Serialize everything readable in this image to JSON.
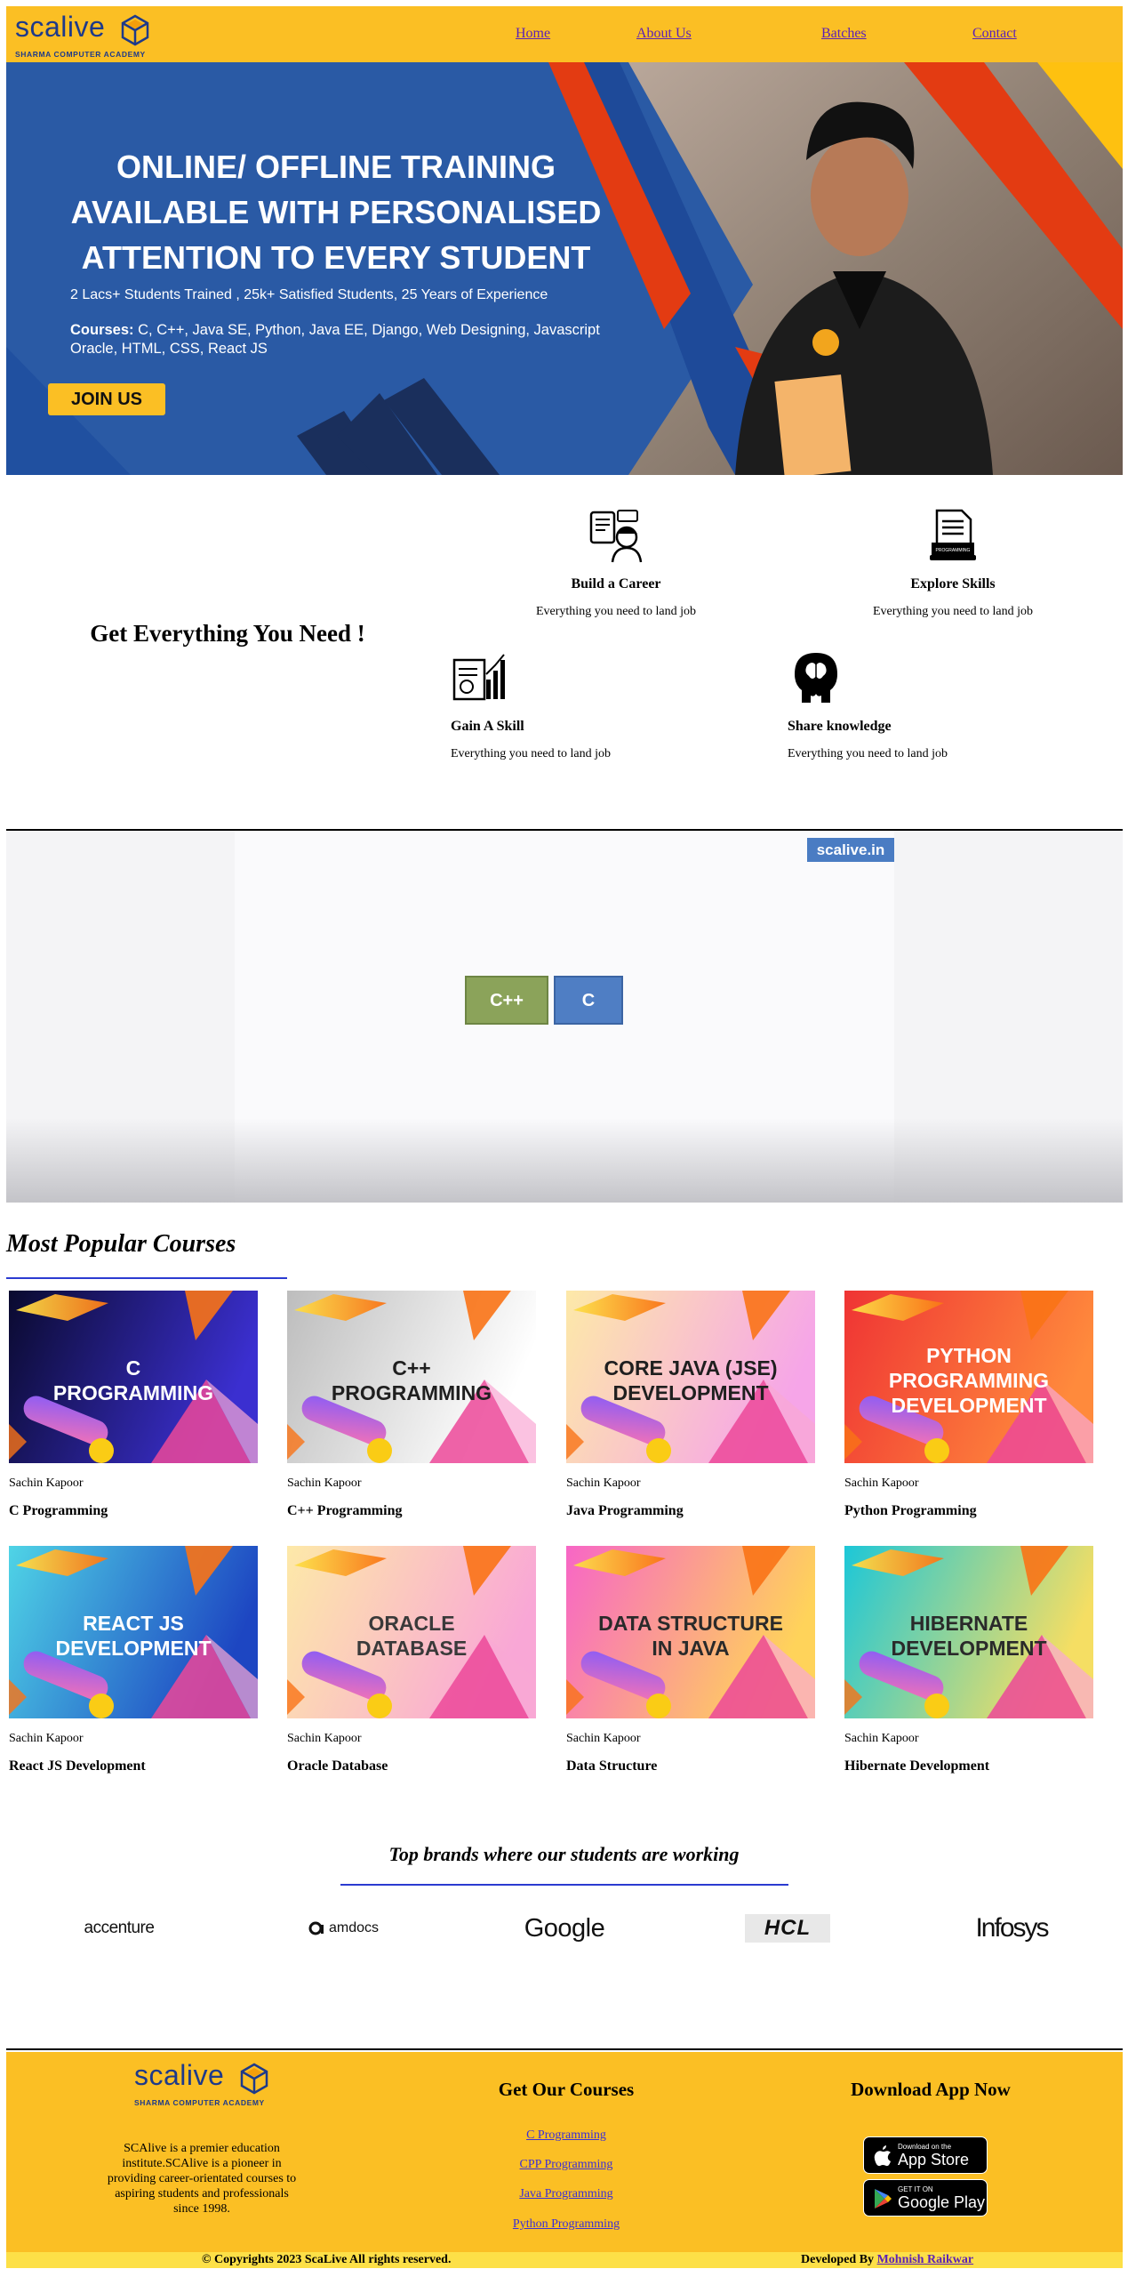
{
  "brand": {
    "name": "scalive",
    "tagline": "SHARMA COMPUTER ACADEMY"
  },
  "nav": {
    "links": [
      "Home",
      "About Us",
      "Batches",
      "Contact"
    ]
  },
  "hero": {
    "title_lines": [
      "ONLINE/ OFFLINE TRAINING",
      "AVAILABLE WITH PERSONALISED",
      "ATTENTION TO EVERY STUDENT"
    ],
    "stats": "2 Lacs+ Students Trained , 25k+ Satisfied Students, 25 Years of Experience",
    "courses_label": "Courses:",
    "courses_line1": " C, C++, Java SE, Python, Java EE, Django, Web Designing, Javascript",
    "courses_line2": "Oracle, HTML, CSS, React JS",
    "cta": "JOIN US"
  },
  "features": {
    "heading": "Get Everything You Need !",
    "items": [
      {
        "title": "Build a Career",
        "desc": "Everything you need to land job",
        "icon": "career-icon"
      },
      {
        "title": "Explore Skills",
        "desc": "Everything you need to land job",
        "icon": "programming-book-icon"
      },
      {
        "title": "Gain A Skill",
        "desc": "Everything you need to land job",
        "icon": "report-chart-icon"
      },
      {
        "title": "Share knowledge",
        "desc": "Everything you need to land job",
        "icon": "head-brain-icon"
      }
    ]
  },
  "video": {
    "brand_badge": "scalive.in",
    "boxes": [
      "C++",
      "C"
    ]
  },
  "courses": {
    "heading": "Most Popular Courses",
    "items": [
      {
        "image_text": "C\nPROGRAMMING",
        "author": "Sachin Kapoor",
        "name": "C Programming",
        "bg_from": "#0a0a2e",
        "bg_to": "#3b2fd0",
        "text_color": "#ffffff"
      },
      {
        "image_text": "C++\nPROGRAMMING",
        "author": "Sachin Kapoor",
        "name": "C++ Programming",
        "bg_from": "#bdbdbd",
        "bg_to": "#ffffff",
        "text_color": "#1f1f1f"
      },
      {
        "image_text": "CORE JAVA (JSE)\nDEVELOPMENT",
        "author": "Sachin Kapoor",
        "name": "Java Programming",
        "bg_from": "#fde9a8",
        "bg_to": "#f6a5e8",
        "text_color": "#1f1f1f"
      },
      {
        "image_text": "PYTHON PROGRAMMING\nDEVELOPMENT",
        "author": "Sachin Kapoor",
        "name": "Python Programming",
        "bg_from": "#ef3434",
        "bg_to": "#ff8a3c",
        "text_color": "#ffffff"
      },
      {
        "image_text": "REACT JS\nDEVELOPMENT",
        "author": "Sachin Kapoor",
        "name": "React JS Development",
        "bg_from": "#4fd4e6",
        "bg_to": "#1d46c2",
        "text_color": "#ffffff"
      },
      {
        "image_text": "ORACLE\nDATABASE",
        "author": "Sachin Kapoor",
        "name": "Oracle Database",
        "bg_from": "#fde9a8",
        "bg_to": "#f9a7d6",
        "text_color": "#3a3a3a"
      },
      {
        "image_text": "DATA STRUCTURE\nIN JAVA",
        "author": "Sachin Kapoor",
        "name": "Data Structure",
        "bg_from": "#f766c6",
        "bg_to": "#ffd35a",
        "text_color": "#2a2a2a"
      },
      {
        "image_text": "HIBERNATE\nDEVELOPMENT",
        "author": "Sachin Kapoor",
        "name": "Hibernate Development",
        "bg_from": "#1cc7d8",
        "bg_to": "#f5de63",
        "text_color": "#2a2a2a"
      }
    ]
  },
  "brands": {
    "heading": "Top brands where our students are working",
    "items": [
      "accenture",
      "amdocs",
      "Google",
      "HCL",
      "Infosys"
    ]
  },
  "footer": {
    "about": "SCAlive is a premier education institute.SCAlive is a pioneer in providing career-orientated courses to aspiring students and professionals since 1998.",
    "courses_heading": "Get Our Courses",
    "course_links": [
      "C Programming",
      "CPP Programming",
      "Java Programming",
      "Python Programming"
    ],
    "app_heading": "Download App Now",
    "app_store": {
      "small": "Download on the",
      "big": "App Store"
    },
    "google_play": {
      "small": "GET IT ON",
      "big": "Google Play"
    },
    "copyright": "© Copyrights 2023 ScaLive All rights reserved.",
    "developed_by": "Developed By",
    "developer": "Mohnish Raikwar"
  }
}
